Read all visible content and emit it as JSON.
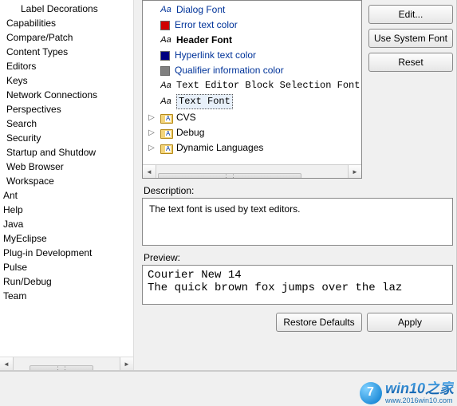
{
  "sidebar": {
    "items": [
      {
        "label": "Label Decorations",
        "indent": 1
      },
      {
        "label": "Capabilities",
        "indent": 0
      },
      {
        "label": "Compare/Patch",
        "indent": 0
      },
      {
        "label": "Content Types",
        "indent": 0
      },
      {
        "label": "Editors",
        "indent": 0
      },
      {
        "label": "Keys",
        "indent": 0
      },
      {
        "label": "Network Connections",
        "indent": 0
      },
      {
        "label": "Perspectives",
        "indent": 0
      },
      {
        "label": "Search",
        "indent": 0
      },
      {
        "label": "Security",
        "indent": 0
      },
      {
        "label": "Startup and Shutdow",
        "indent": 0
      },
      {
        "label": "Web Browser",
        "indent": 0
      },
      {
        "label": "Workspace",
        "indent": 0
      }
    ],
    "roots": [
      {
        "label": "Ant"
      },
      {
        "label": "Help"
      },
      {
        "label": "Java"
      },
      {
        "label": "MyEclipse"
      },
      {
        "label": "Plug-in Development"
      },
      {
        "label": "Pulse"
      },
      {
        "label": "Run/Debug"
      },
      {
        "label": "Team"
      }
    ]
  },
  "fonts": {
    "items": [
      {
        "icon": "aa",
        "label": "Dialog Font",
        "style": "link"
      },
      {
        "icon": "box",
        "color": "#d00000",
        "label": "Error text color",
        "style": "link"
      },
      {
        "icon": "aa",
        "label": "Header Font",
        "style": "header"
      },
      {
        "icon": "box",
        "color": "#000080",
        "label": "Hyperlink text color",
        "style": "link"
      },
      {
        "icon": "box",
        "color": "#808080",
        "label": "Qualifier information color",
        "style": "link"
      },
      {
        "icon": "aa",
        "label": "Text Editor Block Selection Font",
        "style": "mono"
      },
      {
        "icon": "aa",
        "label": "Text Font",
        "style": "mono",
        "selected": true
      }
    ],
    "folders": [
      {
        "label": "CVS"
      },
      {
        "label": "Debug"
      },
      {
        "label": "Dynamic Languages"
      }
    ]
  },
  "buttons": {
    "edit": "Edit...",
    "system": "Use System Font",
    "reset": "Reset",
    "restore": "Restore Defaults",
    "apply": "Apply"
  },
  "labels": {
    "description": "Description:",
    "preview": "Preview:"
  },
  "description_text": "The text font is used by text editors.",
  "preview_text": "Courier New 14\nThe quick brown fox jumps over the laz",
  "watermark": {
    "main": "win10之家",
    "sub": "www.2016win10.com"
  }
}
